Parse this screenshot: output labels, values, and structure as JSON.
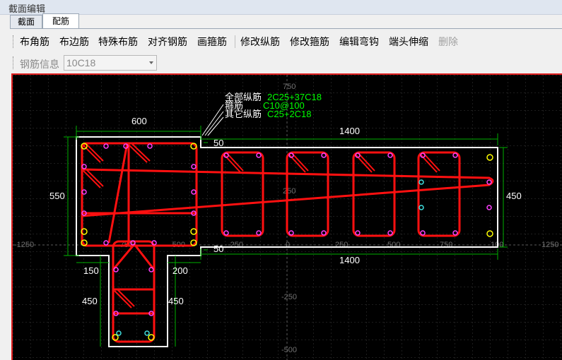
{
  "window": {
    "title": "截面编辑"
  },
  "tabs": [
    {
      "label": "截面"
    },
    {
      "label": "配筋"
    }
  ],
  "toolbar": {
    "buttons": [
      {
        "label": "布角筋"
      },
      {
        "label": "布边筋"
      },
      {
        "label": "特殊布筋"
      },
      {
        "label": "对齐钢筋"
      },
      {
        "label": "画箍筋"
      },
      {
        "label": "修改纵筋"
      },
      {
        "label": "修改箍筋"
      },
      {
        "label": "编辑弯钩"
      },
      {
        "label": "端头伸缩"
      },
      {
        "label": "删除"
      }
    ]
  },
  "rebar_info": {
    "label": "钢筋信息",
    "value": "10C18"
  },
  "drawing": {
    "annotations": {
      "all_long_label": "全部纵筋",
      "all_long_value": "2C25+37C18",
      "stirrup_label": "箍筋",
      "stirrup_value": "C10@100",
      "other_long_label": "其它纵筋",
      "other_long_value": "C25+2C18"
    },
    "dimensions": {
      "top_left_width": "600",
      "top_right_width": "1400",
      "left_height": "550",
      "right_height": "450",
      "notch_top": "50",
      "notch_bottom": "50",
      "bottom_right_width": "1400",
      "web_left_offset": "150",
      "web_right_offset": "200",
      "web_left_height": "450",
      "web_right_height": "450"
    },
    "axis_labels": {
      "y_750": "750",
      "y_250": "250",
      "y_neg250": "-250",
      "y_neg500": "-500",
      "x_neg1250": "-1250",
      "x_neg250": "-250",
      "x_neg500": "-500",
      "x_neg750": "-750",
      "x_0": "0",
      "x_250": "250",
      "x_500": "500",
      "x_750": "750",
      "x_1000": "100",
      "x_1250": "1250"
    },
    "colors": {
      "background": "#000000",
      "outline": "#ffffff",
      "rebar": "#ff0000",
      "dimension": "#00c000",
      "annotation_value": "#00ff00",
      "grid_text": "#606060"
    }
  }
}
